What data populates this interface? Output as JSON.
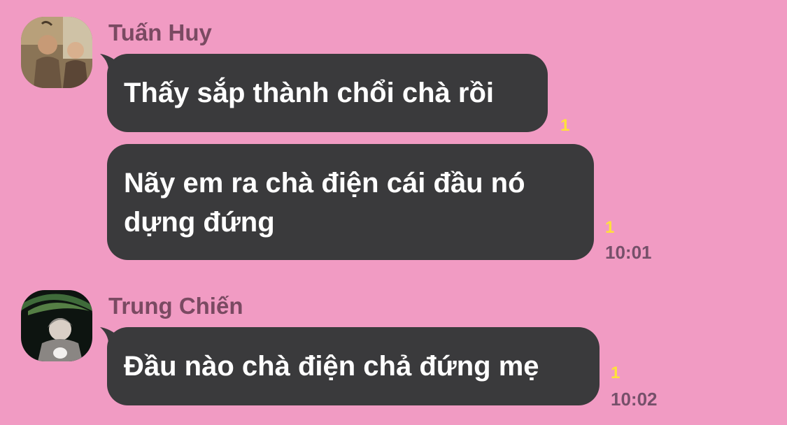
{
  "theme": {
    "background": "#f19bc3",
    "bubble_color": "#3a3a3c",
    "bubble_text_color": "#ffffff",
    "sender_color": "#7a4a62",
    "unread_color": "#ffe13a",
    "time_color": "#76506a"
  },
  "groups": [
    {
      "sender": "Tuấn Huy",
      "avatar_icon": "user-avatar-photo",
      "messages": [
        {
          "text": "Thấy sắp thành chổi chà rồi",
          "unread": "1",
          "time": ""
        },
        {
          "text": "Nãy em ra chà điện cái đầu nó dựng đứng",
          "unread": "1",
          "time": "10:01"
        }
      ]
    },
    {
      "sender": "Trung Chiến",
      "avatar_icon": "user-avatar-photo",
      "messages": [
        {
          "text": "Đầu nào chà điện chả đứng mẹ",
          "unread": "1",
          "time": "10:02"
        }
      ]
    }
  ]
}
